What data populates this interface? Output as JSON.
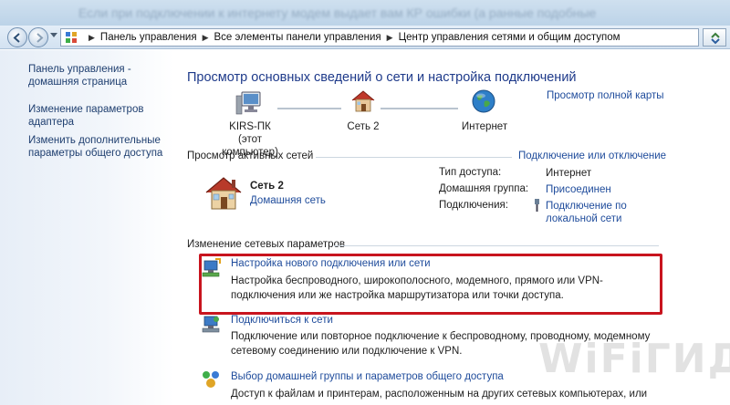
{
  "overlay_text": "Если при подключении к интернету модем выдает вам  КР ошибки (а ранные подобные",
  "address": {
    "crumbs": [
      "Панель управления",
      "Все элементы панели управления",
      "Центр управления сетями и общим доступом"
    ]
  },
  "left": {
    "links": [
      "Панель управления - домашняя страница",
      "Изменение параметров адаптера",
      "Изменить дополнительные параметры общего доступа"
    ]
  },
  "main": {
    "title": "Просмотр основных сведений о сети и настройка подключений",
    "full_map": "Просмотр полной карты",
    "map": {
      "computer_name": "KIRS-ПК",
      "computer_sub": "(этот компьютер)",
      "network": "Сеть  2",
      "internet": "Интернет"
    },
    "active": {
      "header": "Просмотр активных сетей",
      "connect_link": "Подключение или отключение",
      "net_name": "Сеть  2",
      "net_type": "Домашняя сеть",
      "props": [
        {
          "key": "Тип доступа:",
          "value": "Интернет",
          "link": false
        },
        {
          "key": "Домашняя группа:",
          "value": "Присоединен",
          "link": true
        },
        {
          "key": "Подключения:",
          "value": "Подключение по локальной сети",
          "link": true
        }
      ]
    },
    "change": {
      "header": "Изменение сетевых параметров",
      "tasks": [
        {
          "title": "Настройка нового подключения или сети",
          "desc": "Настройка беспроводного, широкополосного, модемного, прямого или VPN-подключения или же настройка маршрутизатора или точки доступа."
        },
        {
          "title": "Подключиться к сети",
          "desc": "Подключение или повторное подключение к беспроводному, проводному, модемному сетевому соединению или подключение к VPN."
        },
        {
          "title": "Выбор домашней группы и параметров общего доступа",
          "desc": "Доступ к файлам и принтерам, расположенным на других сетевых компьютерах, или"
        }
      ]
    }
  },
  "watermark": "WiFiГИД",
  "colors": {
    "accent_link": "#1e4b9b",
    "highlight": "#c8141e",
    "heading": "#1e3a8a"
  },
  "icons": [
    "back-arrow-icon",
    "forward-arrow-icon",
    "control-panel-icon",
    "refresh-icon",
    "computer-icon",
    "home-network-icon",
    "globe-icon",
    "house-icon",
    "network-setup-icon",
    "connect-network-icon",
    "homegroup-icon",
    "network-cable-icon"
  ]
}
